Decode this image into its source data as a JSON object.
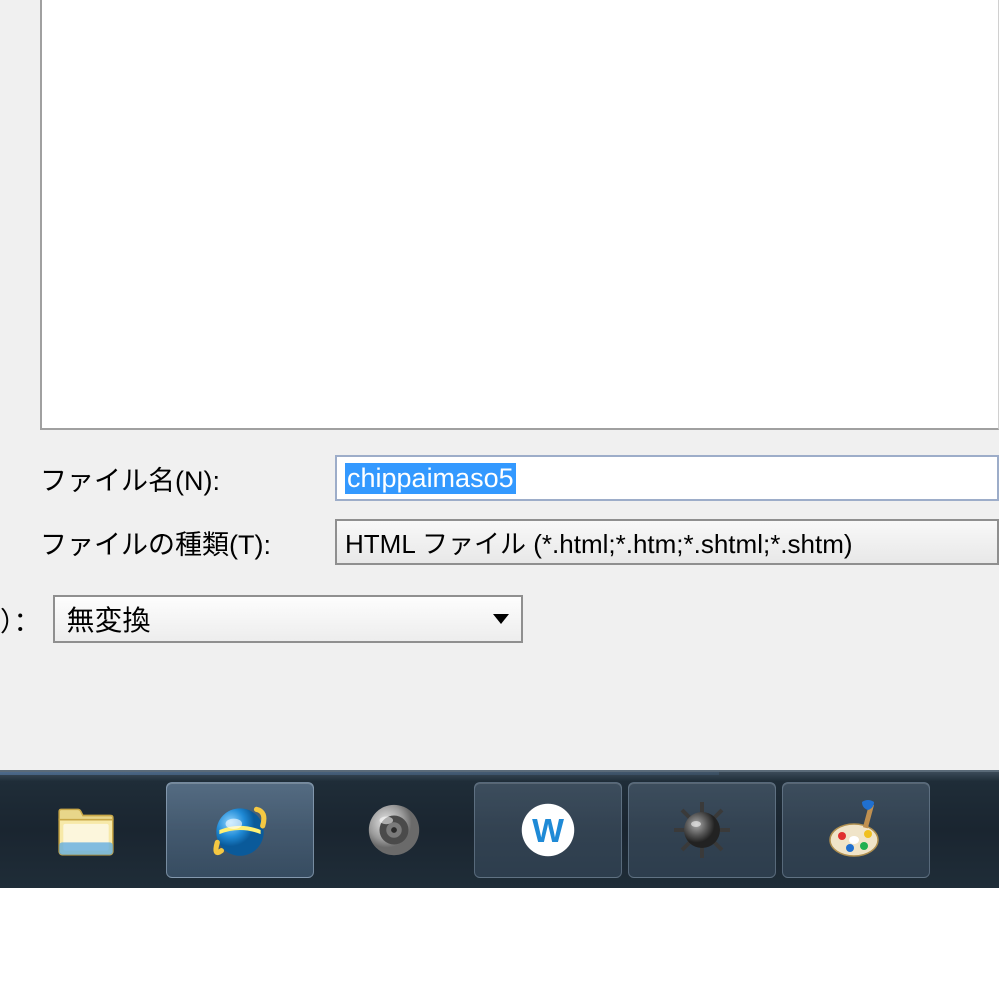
{
  "dialog": {
    "filename_label": "ファイル名(N):",
    "filename_value": "chippaimaso5",
    "filetype_label": "ファイルの種類(T):",
    "filetype_value": "HTML ファイル (*.html;*.htm;*.shtml;*.shtm)",
    "encoding_label": "）：",
    "encoding_value": "無変換"
  },
  "taskbar": {
    "items": [
      {
        "name": "file-explorer",
        "state": "pinned"
      },
      {
        "name": "internet-explorer",
        "state": "active"
      },
      {
        "name": "volume-sound",
        "state": "pinned"
      },
      {
        "name": "w-app",
        "state": "running"
      },
      {
        "name": "minesweeper",
        "state": "running"
      },
      {
        "name": "paint",
        "state": "running"
      }
    ]
  }
}
